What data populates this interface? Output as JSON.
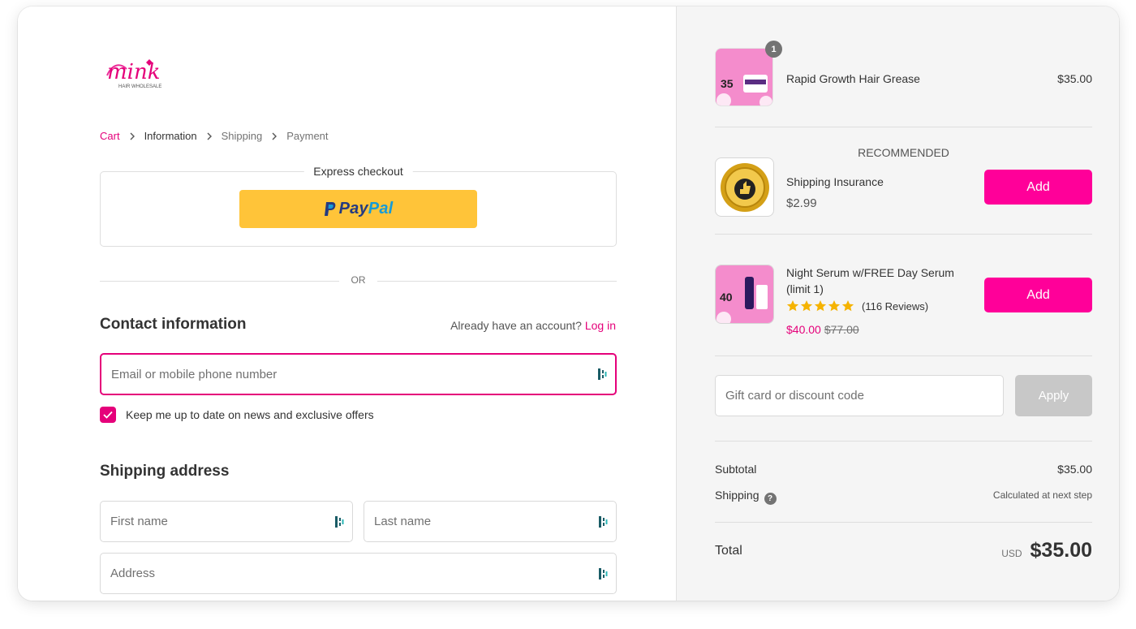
{
  "brand": {
    "logo_text": "mink",
    "logo_subtext": "HAIR WHOLESALE"
  },
  "breadcrumb": [
    {
      "label": "Cart",
      "state": "link"
    },
    {
      "label": "Information",
      "state": "current"
    },
    {
      "label": "Shipping",
      "state": "upcoming"
    },
    {
      "label": "Payment",
      "state": "upcoming"
    }
  ],
  "express": {
    "title": "Express checkout",
    "paypal_p1": "Pay",
    "paypal_p2": "Pal"
  },
  "divider_text": "OR",
  "contact": {
    "heading": "Contact information",
    "account_prompt": "Already have an account?",
    "login_label": "Log in",
    "email_placeholder": "Email or mobile phone number",
    "newsletter_label": "Keep me up to date on news and exclusive offers",
    "newsletter_checked": true
  },
  "shipping_address": {
    "heading": "Shipping address",
    "first_name_placeholder": "First name",
    "last_name_placeholder": "Last name",
    "address_placeholder": "Address"
  },
  "cart": {
    "items": [
      {
        "name": "Rapid Growth Hair Grease",
        "price": "$35.00",
        "quantity": "1",
        "thumb_label": "35"
      }
    ]
  },
  "recommended": {
    "title": "RECOMMENDED",
    "items": [
      {
        "name": "Shipping Insurance",
        "price": "$2.99",
        "button": "Add",
        "icon": "shipping-insurance-seal-icon"
      },
      {
        "name": "Night Serum w/FREE Day Serum (limit 1)",
        "rating": 5,
        "reviews": "(116 Reviews)",
        "sale_price": "$40.00",
        "original_price": "$77.00",
        "button": "Add",
        "thumb_label": "40"
      }
    ]
  },
  "discount": {
    "placeholder": "Gift card or discount code",
    "button": "Apply"
  },
  "summary": {
    "subtotal_label": "Subtotal",
    "subtotal_value": "$35.00",
    "shipping_label": "Shipping",
    "shipping_value": "Calculated at next step",
    "total_label": "Total",
    "currency": "USD",
    "total_value": "$35.00"
  },
  "colors": {
    "accent": "#e5007a",
    "add_button": "#ff0099",
    "paypal_yellow": "#ffc439",
    "star": "#f5b301"
  }
}
